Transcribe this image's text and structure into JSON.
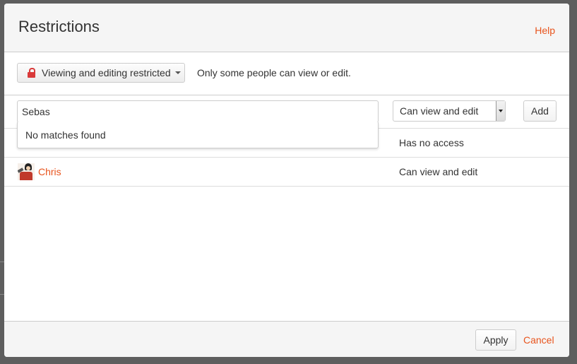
{
  "dialog": {
    "title": "Restrictions",
    "help_label": "Help"
  },
  "toolbar": {
    "restriction_label": "Viewing and editing restricted",
    "restriction_description": "Only some people can view or edit."
  },
  "add_row": {
    "search_value": "Sebas",
    "permission_selected": "Can view and edit",
    "add_label": "Add"
  },
  "autocomplete": {
    "message": "No matches found"
  },
  "users": [
    {
      "name": "",
      "permission": "Has no access"
    },
    {
      "name": "Chris",
      "permission": "Can view and edit"
    }
  ],
  "footer": {
    "apply_label": "Apply",
    "cancel_label": "Cancel"
  },
  "colors": {
    "link": "#e8541d",
    "lock": "#d93a3a"
  }
}
